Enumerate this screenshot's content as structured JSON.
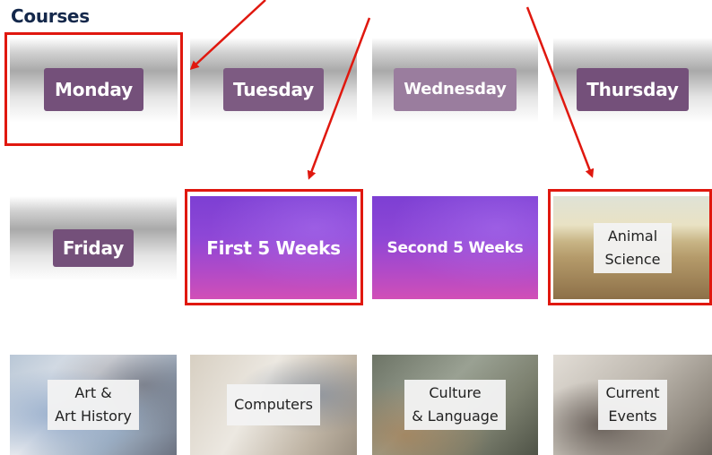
{
  "page": {
    "title": "Courses"
  },
  "rows": [
    [
      {
        "kind": "day",
        "label": "Monday"
      },
      {
        "kind": "day",
        "label": "Tuesday"
      },
      {
        "kind": "day",
        "label": "Wednesday"
      },
      {
        "kind": "day",
        "label": "Thursday"
      }
    ],
    [
      {
        "kind": "day",
        "label": "Friday"
      },
      {
        "kind": "session",
        "label": "First 5 Weeks"
      },
      {
        "kind": "session",
        "label": "Second 5 Weeks"
      },
      {
        "kind": "topic",
        "lines": [
          "Animal",
          "Science"
        ]
      }
    ],
    [
      {
        "kind": "topic",
        "lines": [
          "Art &",
          "Art History"
        ]
      },
      {
        "kind": "topic",
        "lines": [
          "Computers"
        ]
      },
      {
        "kind": "topic",
        "lines": [
          "Culture",
          "& Language"
        ]
      },
      {
        "kind": "topic",
        "lines": [
          "Current",
          "Events"
        ]
      }
    ]
  ],
  "colors": {
    "title": "#14284b",
    "badge": "#74507a",
    "highlight": "#e0180f",
    "purple_tile_top": "#7d3fd3",
    "purple_tile_bottom": "#d14fb7"
  },
  "annotations": {
    "highlighted_tiles": [
      "Monday",
      "First 5 Weeks",
      "Animal Science"
    ],
    "arrow_count": 3
  }
}
